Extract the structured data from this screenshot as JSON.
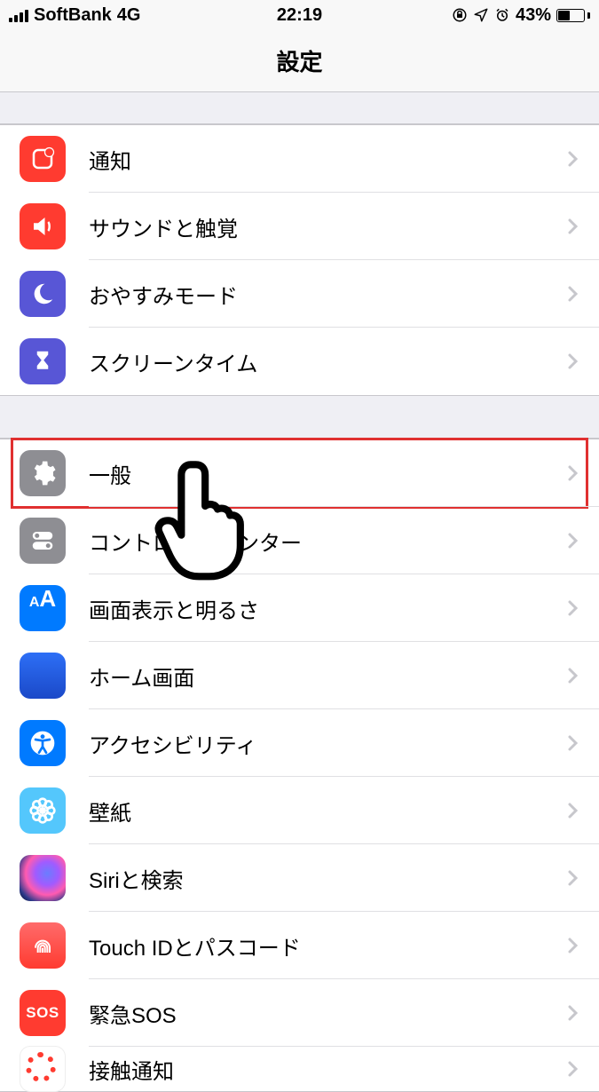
{
  "status": {
    "carrier": "SoftBank",
    "network": "4G",
    "time": "22:19",
    "battery_pct": "43%"
  },
  "nav": {
    "title": "設定"
  },
  "groups": [
    {
      "items": [
        {
          "key": "notifications",
          "label": "通知"
        },
        {
          "key": "sounds",
          "label": "サウンドと触覚"
        },
        {
          "key": "dnd",
          "label": "おやすみモード"
        },
        {
          "key": "screentime",
          "label": "スクリーンタイム"
        }
      ]
    },
    {
      "items": [
        {
          "key": "general",
          "label": "一般",
          "highlighted": true
        },
        {
          "key": "controlcenter",
          "label": "コントロールセンター"
        },
        {
          "key": "display",
          "label": "画面表示と明るさ"
        },
        {
          "key": "homescreen",
          "label": "ホーム画面"
        },
        {
          "key": "accessibility",
          "label": "アクセシビリティ"
        },
        {
          "key": "wallpaper",
          "label": "壁紙"
        },
        {
          "key": "siri",
          "label": "Siriと検索"
        },
        {
          "key": "touchid",
          "label": "Touch IDとパスコード"
        },
        {
          "key": "sos",
          "label": "緊急SOS",
          "sos_text": "SOS"
        },
        {
          "key": "exposure",
          "label": "接触通知"
        }
      ]
    }
  ]
}
